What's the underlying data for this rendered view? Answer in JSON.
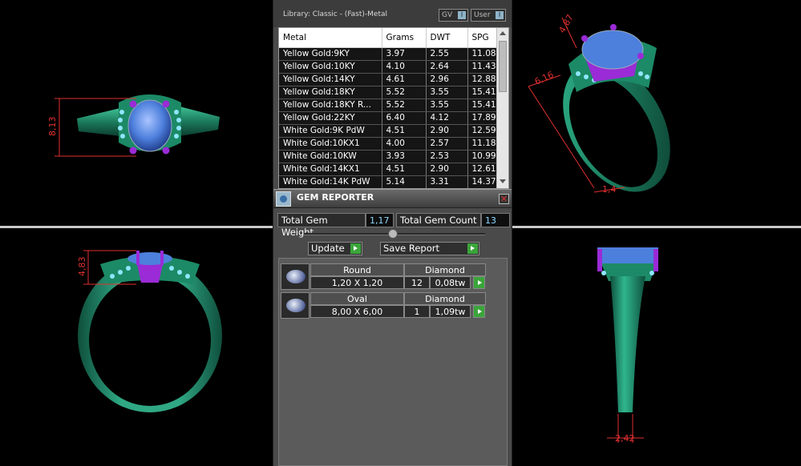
{
  "library": {
    "title": "Library: Classic - (Fast)-Metal",
    "gv_label": "GV",
    "user_label": "User",
    "toggle_glyph": "I"
  },
  "metal_table": {
    "columns": [
      "Metal",
      "Grams",
      "DWT",
      "SPG"
    ],
    "rows": [
      [
        "Yellow Gold:9KY",
        "3.97",
        "2.55",
        "11.08"
      ],
      [
        "Yellow Gold:10KY",
        "4.10",
        "2.64",
        "11.43"
      ],
      [
        "Yellow Gold:14KY",
        "4.61",
        "2.96",
        "12.88"
      ],
      [
        "Yellow Gold:18KY",
        "5.52",
        "3.55",
        "15.41"
      ],
      [
        "Yellow Gold:18KY R...",
        "5.52",
        "3.55",
        "15.41"
      ],
      [
        "Yellow Gold:22KY",
        "6.40",
        "4.12",
        "17.89"
      ],
      [
        "White Gold:9K PdW",
        "4.51",
        "2.90",
        "12.59"
      ],
      [
        "White Gold:10KX1",
        "4.00",
        "2.57",
        "11.18"
      ],
      [
        "White Gold:10KW",
        "3.93",
        "2.53",
        "10.99"
      ],
      [
        "White Gold:14KX1",
        "4.51",
        "2.90",
        "12.61"
      ],
      [
        "White Gold:14K PdW",
        "5.14",
        "3.31",
        "14.37"
      ]
    ]
  },
  "gem_reporter": {
    "title": "GEM REPORTER",
    "close_glyph": "✕",
    "total_weight_label": "Total Gem Weight",
    "total_weight": "1,17",
    "total_count_label": "Total Gem Count",
    "total_count": "13",
    "update_label": "Update",
    "save_label": "Save Report",
    "gems": [
      {
        "shape": "Round",
        "material": "Diamond",
        "size": "1,20 X 1,20",
        "count": "12",
        "weight": "0,08tw"
      },
      {
        "shape": "Oval",
        "material": "Diamond",
        "size": "8,00 X 6,00",
        "count": "1",
        "weight": "1,09tw"
      }
    ]
  },
  "dimensions": {
    "top_left": "8,13",
    "bottom_left": "4,83",
    "top_right_a": "4,87",
    "top_right_b": "6,16",
    "top_right_c": "1,4",
    "bottom_right": "2,42"
  },
  "colors": {
    "metal": "#1f8e6b",
    "gem": "#4d7fdc",
    "prong": "#9a2bd6",
    "accent_gem": "#8fe6ff",
    "dimension": "#e03030"
  }
}
